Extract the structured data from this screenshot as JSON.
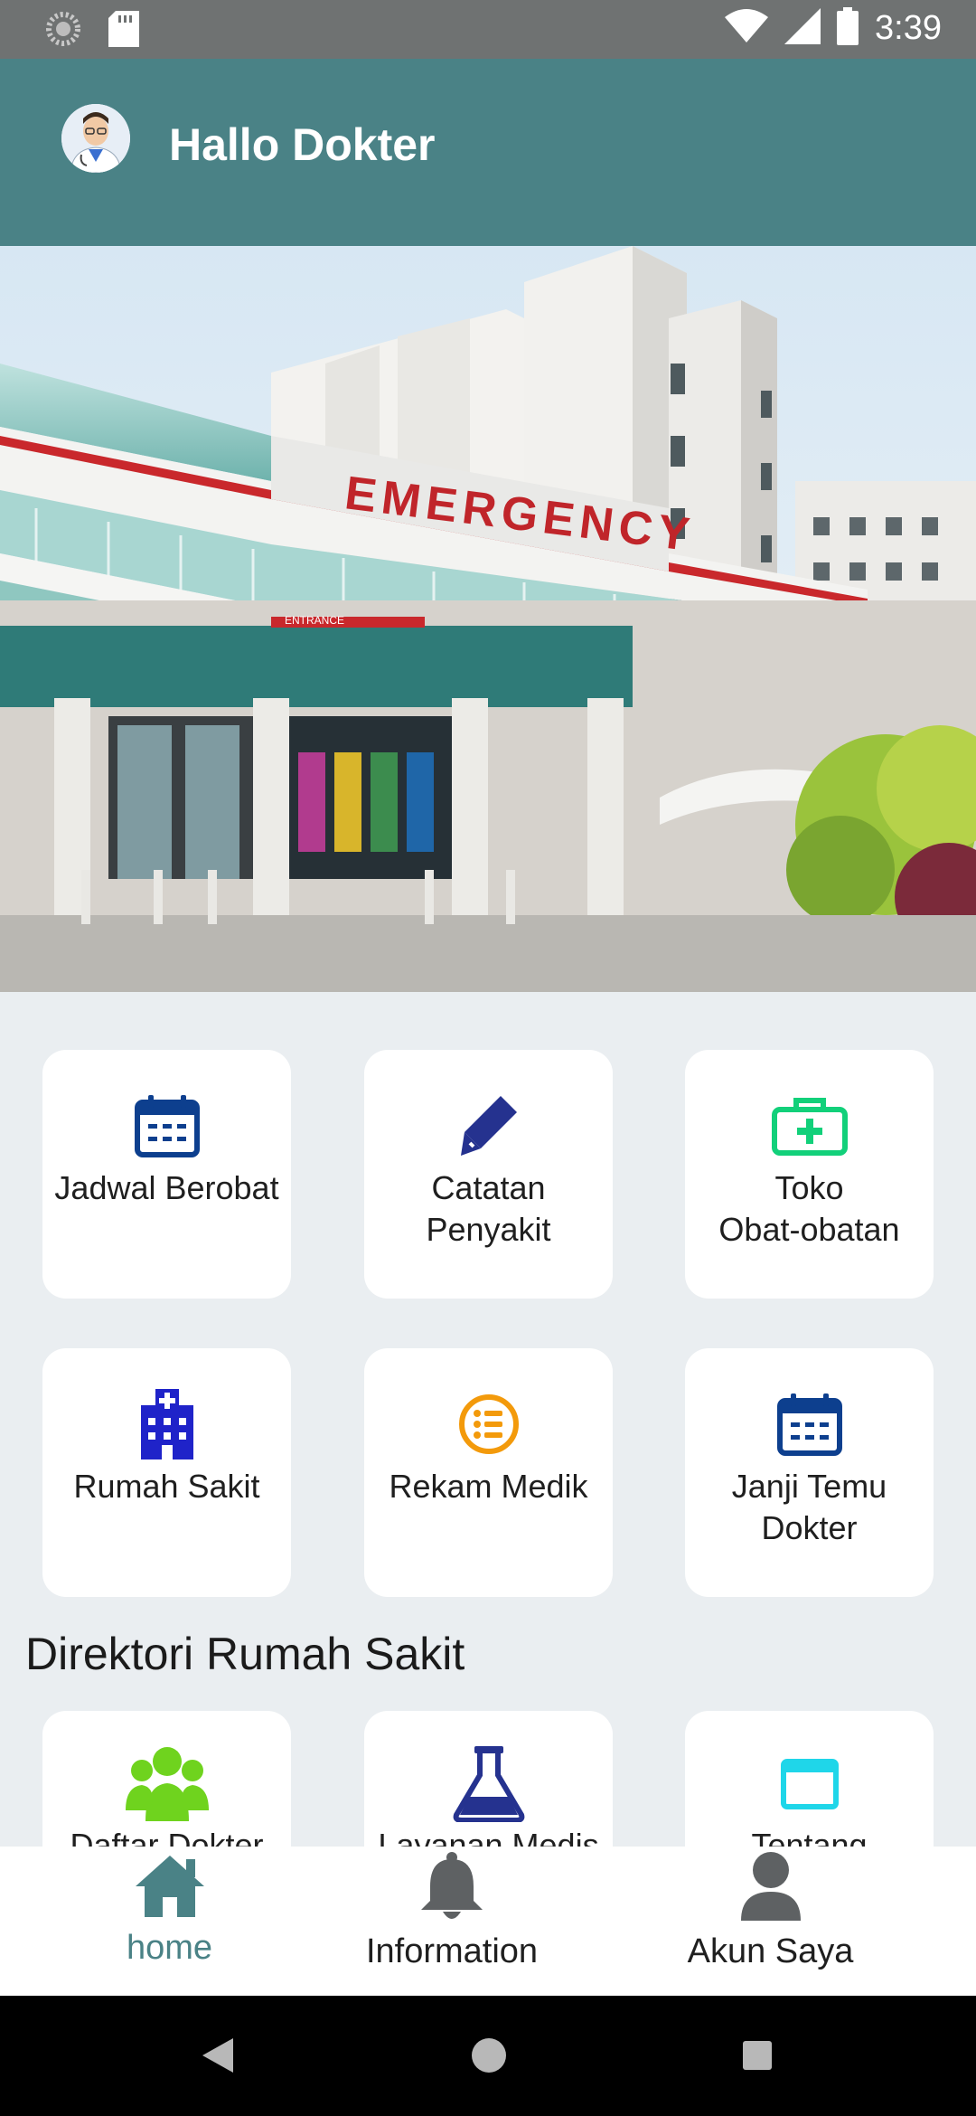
{
  "status_bar": {
    "time": "3:39",
    "icons": [
      "spinner-icon",
      "sd-card-icon",
      "wifi-icon",
      "signal-icon",
      "battery-icon"
    ]
  },
  "app_bar": {
    "title": "Hallo Dokter",
    "avatar_icon": "doctor-avatar-icon",
    "color": "#4a8286"
  },
  "hero": {
    "image": "hospital-emergency-photo",
    "sign_text": "EMERGENCY",
    "entrance_text": "ENTRANCE"
  },
  "menu": [
    {
      "label": "Jadwal Berobat",
      "icon": "calendar-icon",
      "color": "#0d3f8e"
    },
    {
      "label": "Catatan\nPenyakit",
      "icon": "pencil-icon",
      "color": "#25328f"
    },
    {
      "label": "Toko\nObat-obatan",
      "icon": "medkit-icon",
      "color": "#12d07a"
    },
    {
      "label": "Rumah Sakit",
      "icon": "hospital-icon",
      "color": "#1f23c9"
    },
    {
      "label": "Rekam Medik",
      "icon": "list-circle-icon",
      "color": "#f39a0b"
    },
    {
      "label": "Janji Temu\nDokter",
      "icon": "calendar-icon",
      "color": "#0d3f8e"
    }
  ],
  "directory": {
    "title": "Direktori Rumah Sakit",
    "items": [
      {
        "label": "Daftar Dokter",
        "icon": "users-icon",
        "color": "#6fd31e"
      },
      {
        "label": "Layanan Medis",
        "icon": "flask-icon",
        "color": "#25328f"
      },
      {
        "label": "Tentang",
        "icon": "window-icon",
        "color": "#1fd6e9"
      }
    ]
  },
  "bottom_nav": [
    {
      "label": "home",
      "icon": "home-icon",
      "active": true
    },
    {
      "label": "Information",
      "icon": "bell-icon",
      "active": false
    },
    {
      "label": "Akun Saya",
      "icon": "user-icon",
      "active": false
    }
  ],
  "system_nav": {
    "icons": [
      "back-icon",
      "home-circle-icon",
      "recents-icon"
    ]
  }
}
